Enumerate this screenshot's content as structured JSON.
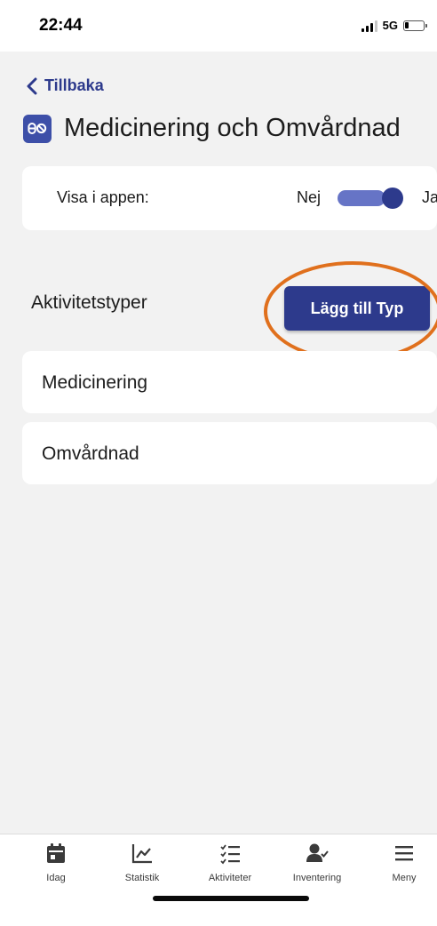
{
  "status_bar": {
    "time": "22:44",
    "network": "5G",
    "icons": [
      "signal-icon",
      "battery-icon"
    ]
  },
  "header": {
    "back_label": "Tillbaka",
    "title": "Medicinering och Omvårdnad",
    "title_icon": "pills-icon"
  },
  "visibility": {
    "label": "Visa i appen:",
    "off_label": "Nej",
    "on_label": "Ja",
    "enabled": true
  },
  "activity_types": {
    "heading": "Aktivitetstyper",
    "add_button_label": "Lägg till Typ",
    "items": [
      "Medicinering",
      "Omvårdnad"
    ]
  },
  "tab_bar": {
    "tabs": [
      {
        "label": "Idag",
        "icon": "calendar-icon"
      },
      {
        "label": "Statistik",
        "icon": "chart-icon"
      },
      {
        "label": "Aktiviteter",
        "icon": "checklist-icon"
      },
      {
        "label": "Inventering",
        "icon": "person-check-icon"
      },
      {
        "label": "Meny",
        "icon": "menu-icon"
      }
    ]
  },
  "colors": {
    "primary": "#2d3a8c",
    "toggle_track": "#6674c6",
    "highlight": "#e0701d",
    "background": "#f2f2f2"
  }
}
